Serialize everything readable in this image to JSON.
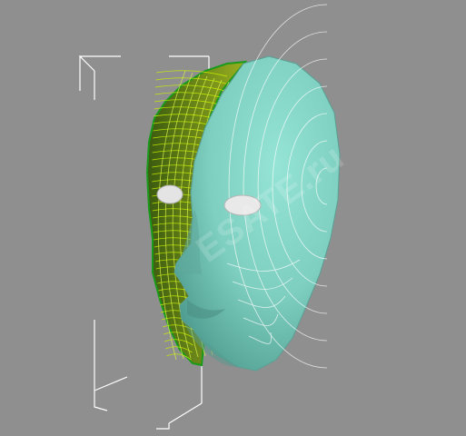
{
  "viewport": {
    "background": "#8f8f8f",
    "object": {
      "name": "head-mesh",
      "surface_color": "#7ecfc0",
      "wireframe_color": "#c8f000",
      "bounding_box_color": "#ffffff",
      "eye_color": "#e9e9e9",
      "isoline_color": "#ffffff"
    },
    "watermark": "ESATE.ru"
  }
}
